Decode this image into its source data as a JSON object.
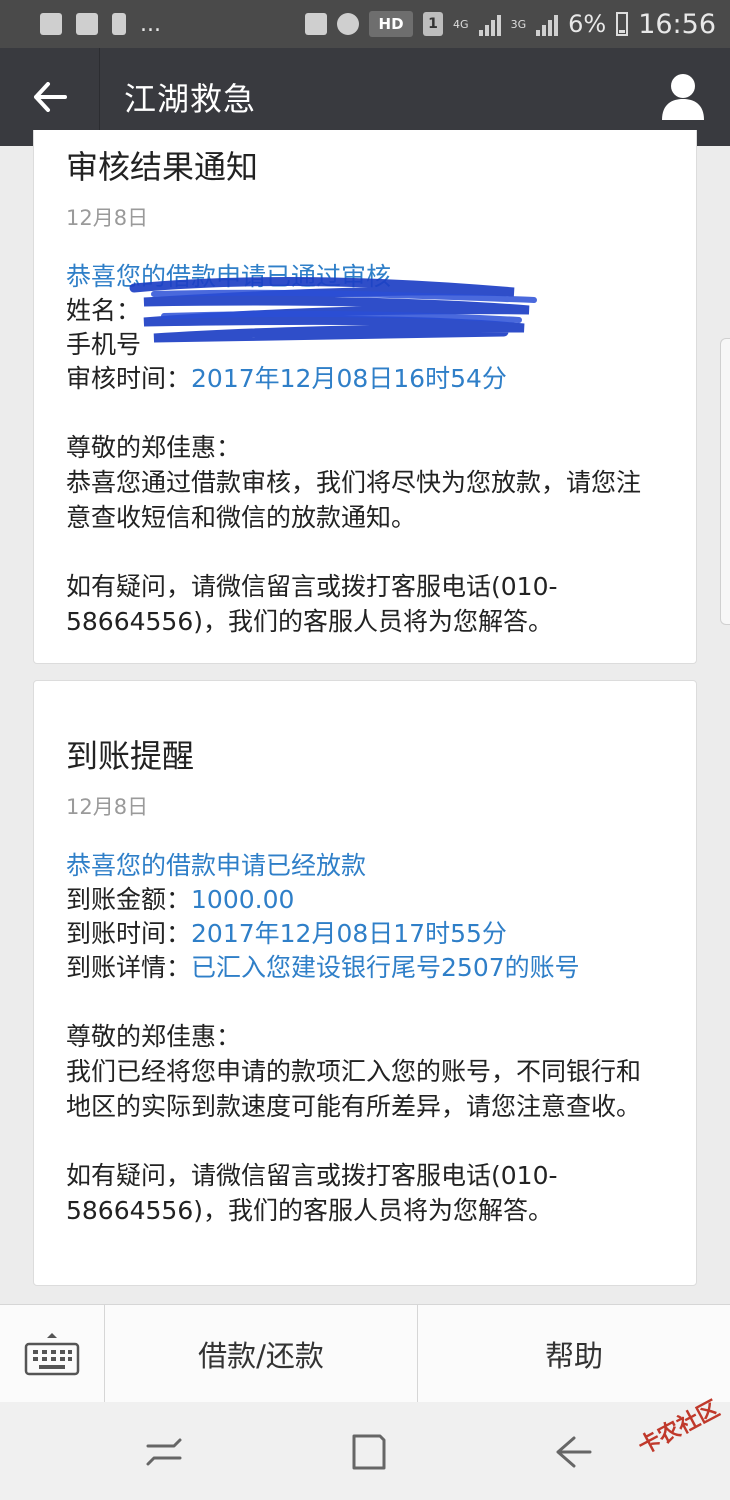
{
  "status_bar": {
    "network_4g": "4G",
    "network_3g": "3G",
    "hd": "HD",
    "sim": "1",
    "battery": "6%",
    "time": "16:56"
  },
  "app_bar": {
    "title": "江湖救急",
    "back_icon": "arrow-left-icon",
    "profile_icon": "person-icon"
  },
  "messages": [
    {
      "title": "审核结果通知",
      "date": "12月8日",
      "headline": "恭喜您的借款申请已通过审核",
      "name_label": "姓名：",
      "phone_label": "手机号",
      "time_label": "审核时间：",
      "time_value": "2017年12月08日16时54分",
      "greeting": "尊敬的郑佳惠：",
      "body": "恭喜您通过借款审核，我们将尽快为您放款，请您注意查收短信和微信的放款通知。",
      "contact": "如有疑问，请微信留言或拨打客服电话(010-58664556)，我们的客服人员将为您解答。"
    },
    {
      "title": "到账提醒",
      "date": "12月8日",
      "headline": "恭喜您的借款申请已经放款",
      "amount_label": "到账金额：",
      "amount_value": "1000.00",
      "time_label": "到账时间：",
      "time_value": "2017年12月08日17时55分",
      "detail_label": "到账详情：",
      "detail_value": "已汇入您建设银行尾号2507的账号",
      "greeting": "尊敬的郑佳惠：",
      "body": "我们已经将您申请的款项汇入您的账号，不同银行和地区的实际到款速度可能有所差异，请您注意查收。",
      "contact": "如有疑问，请微信留言或拨打客服电话(010-58664556)，我们的客服人员将为您解答。"
    }
  ],
  "menu": {
    "keyboard_icon": "keyboard-icon",
    "items": [
      "借款/还款",
      "帮助"
    ]
  },
  "watermark": "卡农社区",
  "colors": {
    "app_bar": "#393a3f",
    "status_bar": "#4a4a4a",
    "link_blue": "#2f7fc8",
    "background": "#ececec"
  }
}
